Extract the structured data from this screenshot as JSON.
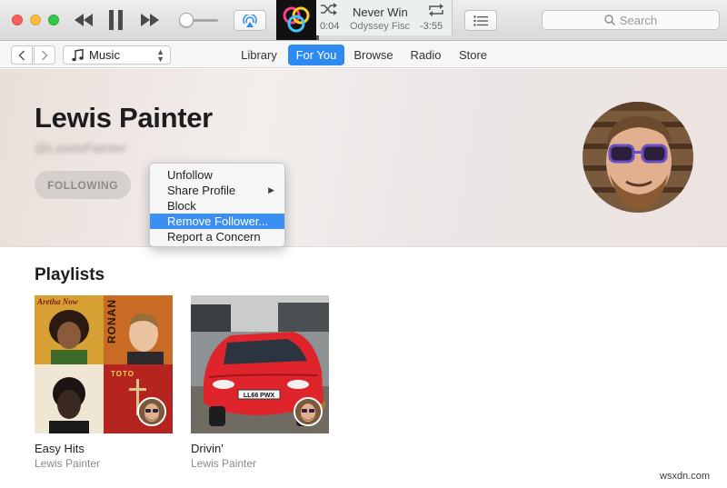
{
  "window": {
    "title_controls": [
      "close",
      "minimize",
      "zoom"
    ]
  },
  "player": {
    "track_title": "Never Win",
    "track_subtitle": "Odyssey  Fisc",
    "elapsed": "0:04",
    "remaining": "-3:55",
    "progress": 0.02,
    "volume": 0.1,
    "icons": [
      "rewind-icon",
      "pause-icon",
      "fast-forward-icon",
      "airplay-icon",
      "shuffle-icon",
      "repeat-icon",
      "up-next-list-icon"
    ]
  },
  "search": {
    "placeholder": "Search"
  },
  "nav": {
    "media_type": "Music",
    "tabs": [
      {
        "label": "Library",
        "active": false
      },
      {
        "label": "For You",
        "active": true
      },
      {
        "label": "Browse",
        "active": false
      },
      {
        "label": "Radio",
        "active": false
      },
      {
        "label": "Store",
        "active": false
      }
    ]
  },
  "profile": {
    "name": "Lewis Painter",
    "handle": "@LewisPainter",
    "follow_label": "FOLLOWING"
  },
  "context_menu": {
    "items": [
      {
        "label": "Unfollow",
        "submenu": false,
        "selected": false
      },
      {
        "label": "Share Profile",
        "submenu": true,
        "selected": false
      },
      {
        "label": "Block",
        "submenu": false,
        "selected": false
      },
      {
        "label": "Remove Follower...",
        "submenu": false,
        "selected": true
      },
      {
        "label": "Report a Concern",
        "submenu": false,
        "selected": false
      }
    ]
  },
  "playlists": {
    "heading": "Playlists",
    "items": [
      {
        "name": "Easy Hits",
        "owner": "Lewis Painter",
        "art_labels": [
          "Aretha Now",
          "RONAN",
          "TOTO"
        ]
      },
      {
        "name": "Drivin'",
        "owner": "Lewis Painter",
        "art_labels": [
          "LL66 PWX"
        ]
      }
    ]
  },
  "colors": {
    "accent": "#2d8af0",
    "menu_highlight": "#3b8ff2",
    "hero_background": "#ebe5e2"
  },
  "watermark": "wsxdn.com"
}
